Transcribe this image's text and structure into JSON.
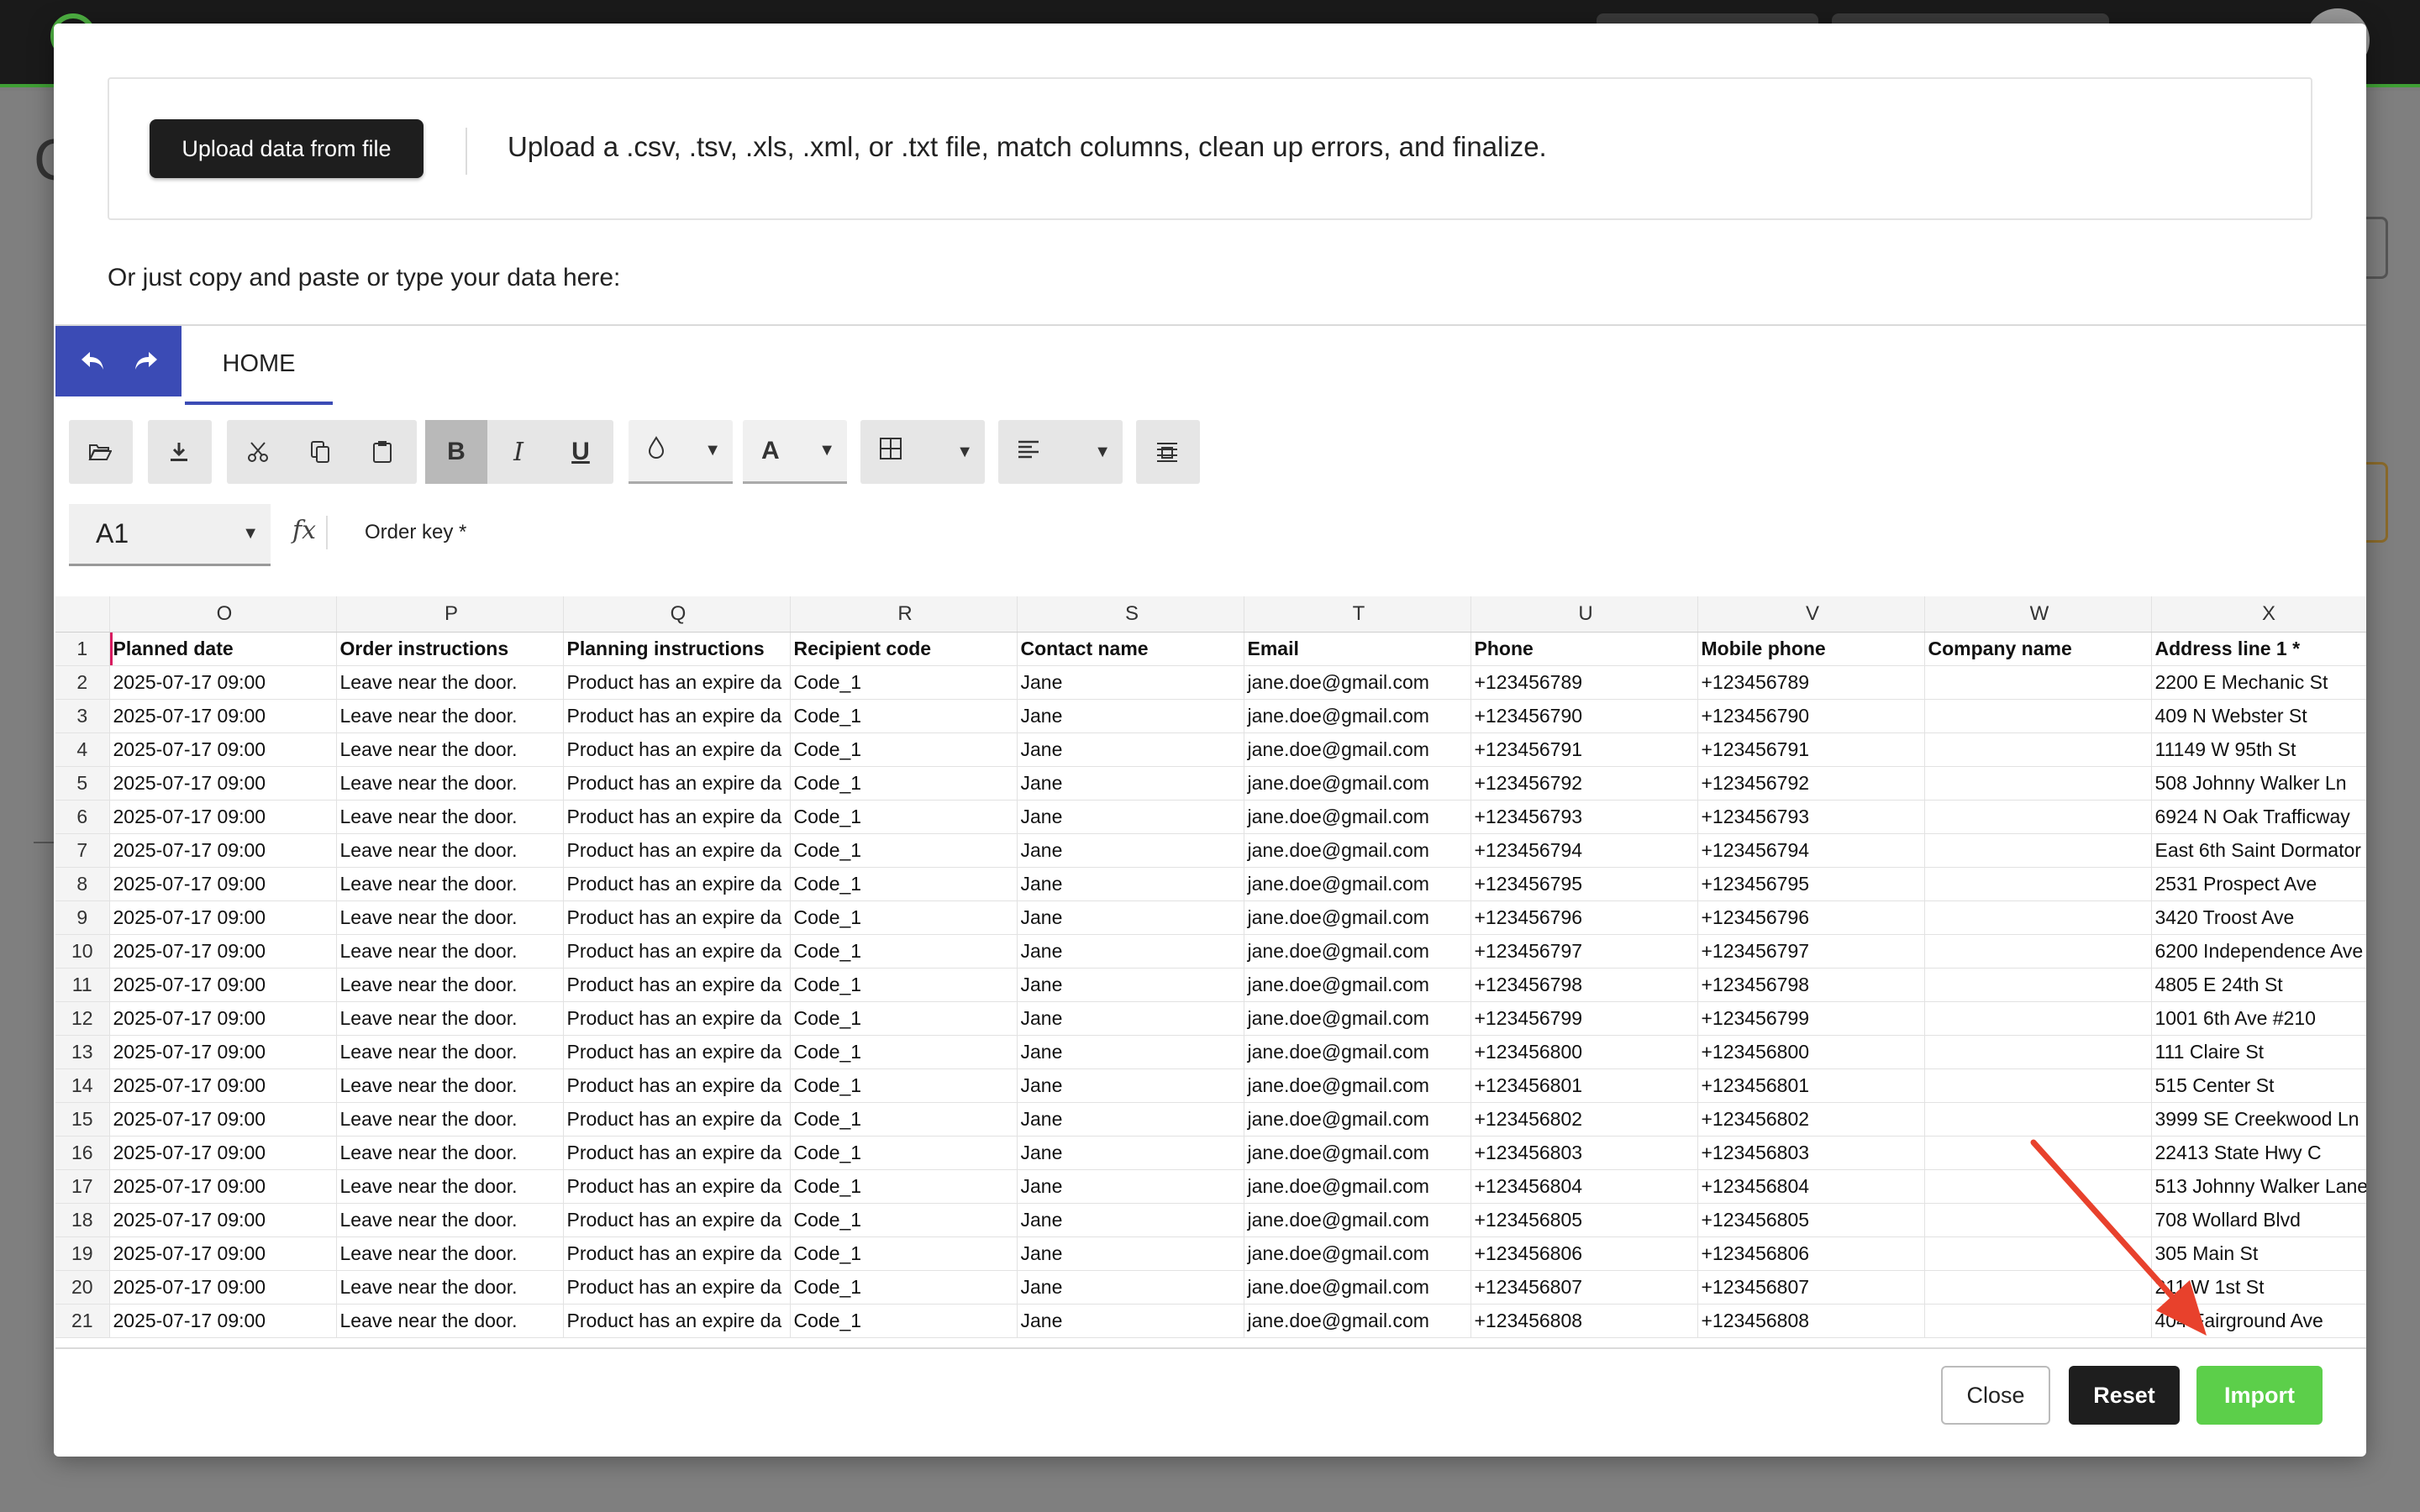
{
  "modal": {
    "upload_button": "Upload data from file",
    "upload_description": "Upload a .csv, .tsv, .xls, .xml, or .txt file, match columns, clean up errors, and finalize.",
    "paste_hint": "Or just copy and paste or type your data here:"
  },
  "sheet": {
    "tab": "HOME",
    "namebox": "A1",
    "fx_label": "fx",
    "formula": "Order key *",
    "toolbar": {
      "bold": "B",
      "italic": "I",
      "underline": "U",
      "font_color": "A"
    },
    "columns": [
      "O",
      "P",
      "Q",
      "R",
      "S",
      "T",
      "U",
      "V",
      "W",
      "X"
    ],
    "header_row": [
      "Planned date",
      "Order instructions",
      "Planning instructions",
      "Recipient code",
      "Contact name",
      "Email",
      "Phone",
      "Mobile phone",
      "Company name",
      "Address line 1 *"
    ],
    "rows": [
      [
        "2",
        "2025-07-17 09:00",
        "Leave near the door.",
        "Product has an expire da",
        "Code_1",
        "Jane",
        "jane.doe@gmail.com",
        "+123456789",
        "+123456789",
        "",
        "2200 E Mechanic St"
      ],
      [
        "3",
        "2025-07-17 09:00",
        "Leave near the door.",
        "Product has an expire da",
        "Code_1",
        "Jane",
        "jane.doe@gmail.com",
        "+123456790",
        "+123456790",
        "",
        "409 N Webster St"
      ],
      [
        "4",
        "2025-07-17 09:00",
        "Leave near the door.",
        "Product has an expire da",
        "Code_1",
        "Jane",
        "jane.doe@gmail.com",
        "+123456791",
        "+123456791",
        "",
        "11149 W 95th St"
      ],
      [
        "5",
        "2025-07-17 09:00",
        "Leave near the door.",
        "Product has an expire da",
        "Code_1",
        "Jane",
        "jane.doe@gmail.com",
        "+123456792",
        "+123456792",
        "",
        "508 Johnny Walker Ln"
      ],
      [
        "6",
        "2025-07-17 09:00",
        "Leave near the door.",
        "Product has an expire da",
        "Code_1",
        "Jane",
        "jane.doe@gmail.com",
        "+123456793",
        "+123456793",
        "",
        "6924 N Oak Trafficway"
      ],
      [
        "7",
        "2025-07-17 09:00",
        "Leave near the door.",
        "Product has an expire da",
        "Code_1",
        "Jane",
        "jane.doe@gmail.com",
        "+123456794",
        "+123456794",
        "",
        "East 6th Saint Dormator"
      ],
      [
        "8",
        "2025-07-17 09:00",
        "Leave near the door.",
        "Product has an expire da",
        "Code_1",
        "Jane",
        "jane.doe@gmail.com",
        "+123456795",
        "+123456795",
        "",
        "2531 Prospect Ave"
      ],
      [
        "9",
        "2025-07-17 09:00",
        "Leave near the door.",
        "Product has an expire da",
        "Code_1",
        "Jane",
        "jane.doe@gmail.com",
        "+123456796",
        "+123456796",
        "",
        "3420 Troost Ave"
      ],
      [
        "10",
        "2025-07-17 09:00",
        "Leave near the door.",
        "Product has an expire da",
        "Code_1",
        "Jane",
        "jane.doe@gmail.com",
        "+123456797",
        "+123456797",
        "",
        "6200 Independence Ave"
      ],
      [
        "11",
        "2025-07-17 09:00",
        "Leave near the door.",
        "Product has an expire da",
        "Code_1",
        "Jane",
        "jane.doe@gmail.com",
        "+123456798",
        "+123456798",
        "",
        "4805 E 24th St"
      ],
      [
        "12",
        "2025-07-17 09:00",
        "Leave near the door.",
        "Product has an expire da",
        "Code_1",
        "Jane",
        "jane.doe@gmail.com",
        "+123456799",
        "+123456799",
        "",
        "1001 6th Ave #210"
      ],
      [
        "13",
        "2025-07-17 09:00",
        "Leave near the door.",
        "Product has an expire da",
        "Code_1",
        "Jane",
        "jane.doe@gmail.com",
        "+123456800",
        "+123456800",
        "",
        "111 Claire St"
      ],
      [
        "14",
        "2025-07-17 09:00",
        "Leave near the door.",
        "Product has an expire da",
        "Code_1",
        "Jane",
        "jane.doe@gmail.com",
        "+123456801",
        "+123456801",
        "",
        "515 Center St"
      ],
      [
        "15",
        "2025-07-17 09:00",
        "Leave near the door.",
        "Product has an expire da",
        "Code_1",
        "Jane",
        "jane.doe@gmail.com",
        "+123456802",
        "+123456802",
        "",
        "3999 SE Creekwood Ln"
      ],
      [
        "16",
        "2025-07-17 09:00",
        "Leave near the door.",
        "Product has an expire da",
        "Code_1",
        "Jane",
        "jane.doe@gmail.com",
        "+123456803",
        "+123456803",
        "",
        "22413 State Hwy C"
      ],
      [
        "17",
        "2025-07-17 09:00",
        "Leave near the door.",
        "Product has an expire da",
        "Code_1",
        "Jane",
        "jane.doe@gmail.com",
        "+123456804",
        "+123456804",
        "",
        "513 Johnny Walker Lane"
      ],
      [
        "18",
        "2025-07-17 09:00",
        "Leave near the door.",
        "Product has an expire da",
        "Code_1",
        "Jane",
        "jane.doe@gmail.com",
        "+123456805",
        "+123456805",
        "",
        "708 Wollard Blvd"
      ],
      [
        "19",
        "2025-07-17 09:00",
        "Leave near the door.",
        "Product has an expire da",
        "Code_1",
        "Jane",
        "jane.doe@gmail.com",
        "+123456806",
        "+123456806",
        "",
        "305 Main St"
      ],
      [
        "20",
        "2025-07-17 09:00",
        "Leave near the door.",
        "Product has an expire da",
        "Code_1",
        "Jane",
        "jane.doe@gmail.com",
        "+123456807",
        "+123456807",
        "",
        "211 W 1st St"
      ],
      [
        "21",
        "2025-07-17 09:00",
        "Leave near the door.",
        "Product has an expire da",
        "Code_1",
        "Jane",
        "jane.doe@gmail.com",
        "+123456808",
        "+123456808",
        "",
        "404 Fairground Ave"
      ]
    ]
  },
  "footer": {
    "close": "Close",
    "reset": "Reset",
    "import": "Import"
  },
  "icons": {
    "undo": "undo-arrow-icon",
    "redo": "redo-arrow-icon",
    "open": "folder-open-icon",
    "download": "download-icon",
    "cut": "scissors-icon",
    "copy": "copy-icon",
    "paste": "clipboard-icon",
    "fill": "fill-drop-icon",
    "borders": "borders-grid-icon",
    "align": "align-left-icon",
    "wrap": "wrap-text-icon"
  },
  "colors": {
    "accent": "#3b4bb5",
    "import_button": "#5ccf4a",
    "annotation_arrow": "#e8412c",
    "selection": "#d81b60"
  }
}
